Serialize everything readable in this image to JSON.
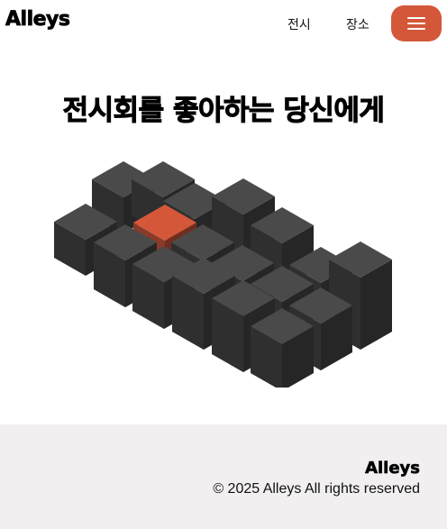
{
  "header": {
    "logo": "Alleys",
    "nav": [
      {
        "label": "전시"
      },
      {
        "label": "장소"
      }
    ],
    "menu_icon": "hamburger-menu-icon"
  },
  "hero": {
    "title": "전시회를 좋아하는 당신에게",
    "illustration": "isometric-cubes-illustration"
  },
  "footer": {
    "logo": "Alleys",
    "copyright": "© 2025 Alleys All rights reserved"
  },
  "colors": {
    "accent": "#d4573a",
    "cube_top": "#4a4a4a",
    "cube_left": "#2f2f2f",
    "cube_right": "#262626",
    "footer_bg": "#f1efef"
  }
}
